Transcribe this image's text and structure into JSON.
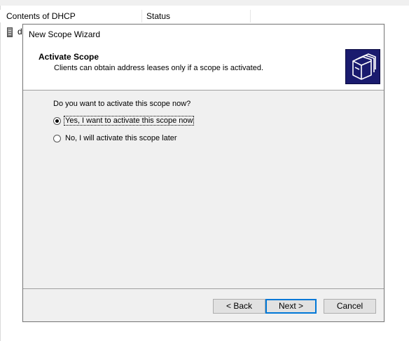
{
  "background": {
    "columns": [
      "Contents of DHCP",
      "Status"
    ],
    "row_text": "d"
  },
  "dialog": {
    "title": "New Scope Wizard",
    "header": {
      "title": "Activate Scope",
      "subtitle": "Clients can obtain address leases only if a scope is activated.",
      "icon": "wizard-folders-icon"
    },
    "question": "Do you want to activate this scope now?",
    "options": [
      {
        "label": "Yes, I want to activate this scope now",
        "checked": true
      },
      {
        "label": "No, I will activate this scope later",
        "checked": false
      }
    ],
    "buttons": {
      "back": "< Back",
      "next": "Next >",
      "cancel": "Cancel"
    }
  },
  "colors": {
    "dialog_bg": "#f0f0f0",
    "icon_bg": "#1a1b6e",
    "default_button_border": "#0078d7"
  }
}
